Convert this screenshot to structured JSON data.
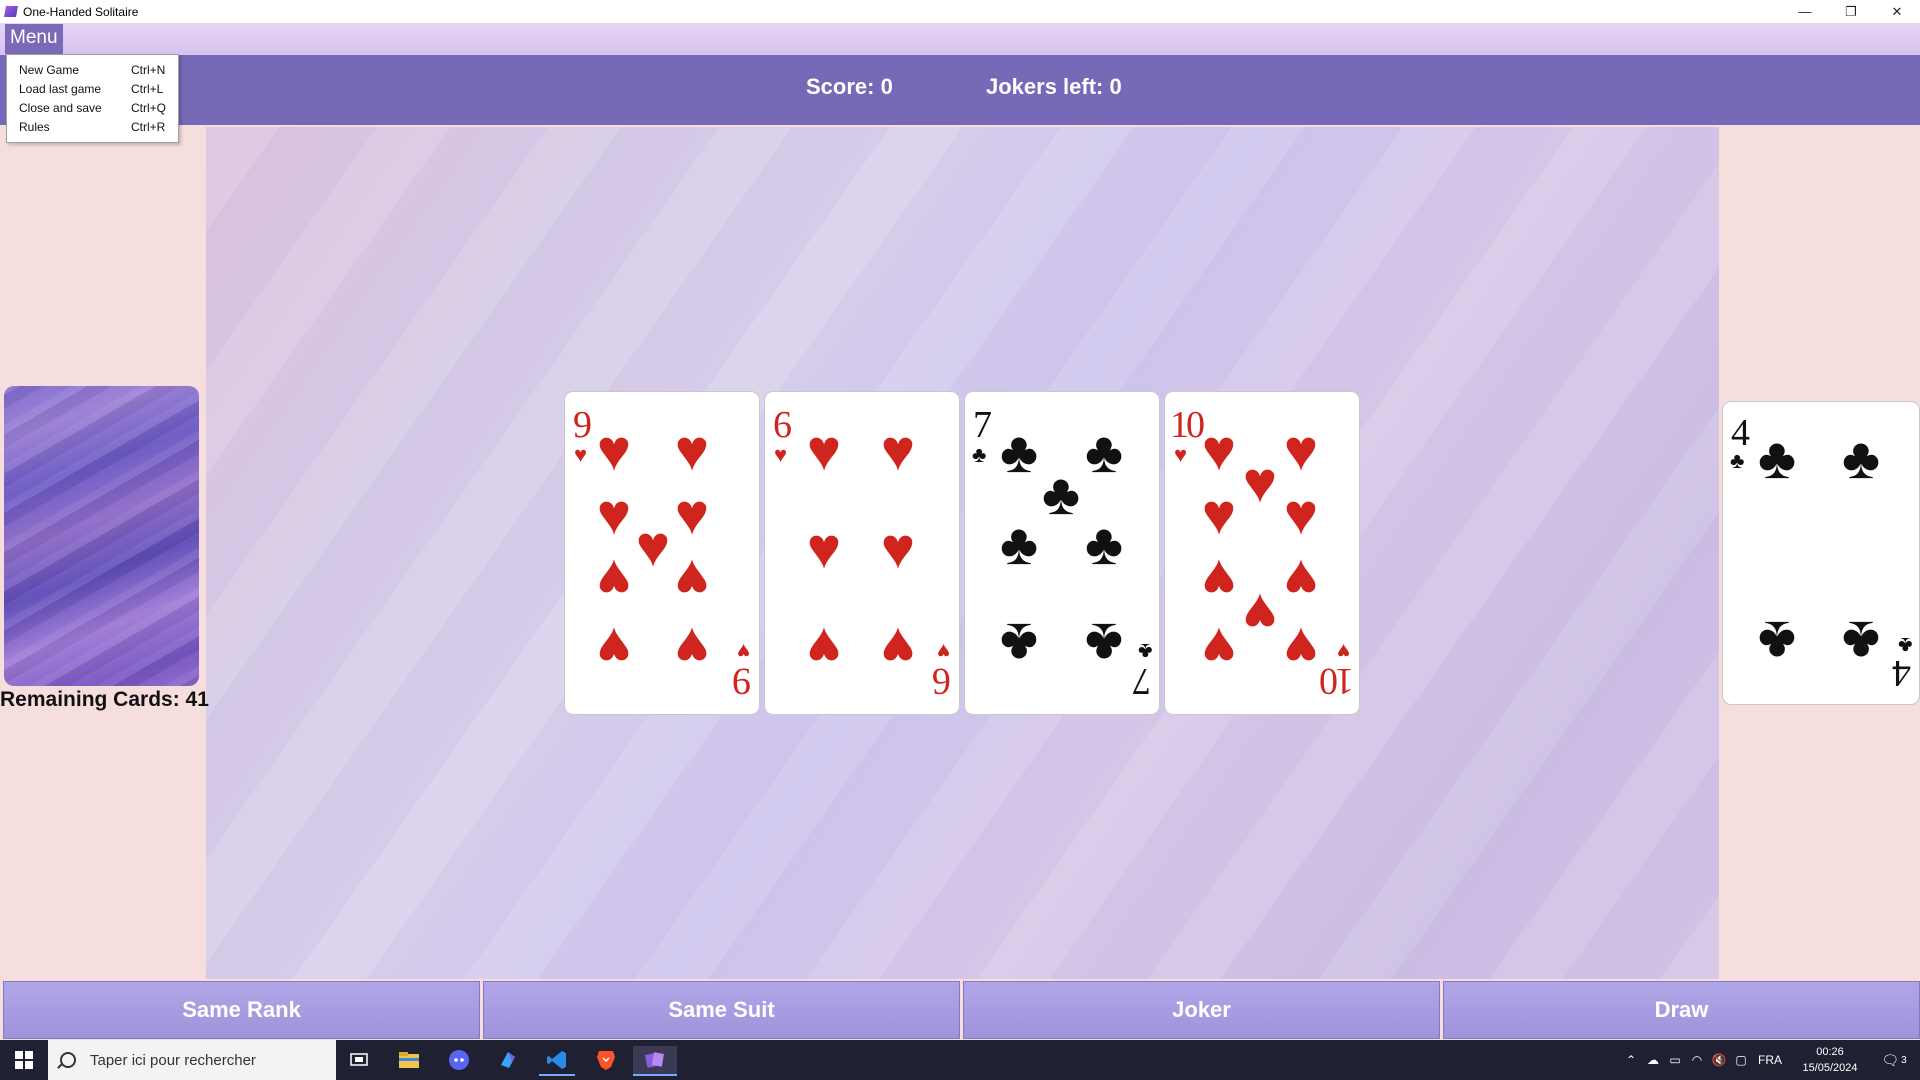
{
  "window": {
    "title": "One-Handed Solitaire",
    "minimize": "—",
    "restore": "❐",
    "close": "✕"
  },
  "menu": {
    "label": "Menu",
    "items": [
      {
        "label": "New Game",
        "shortcut": "Ctrl+N"
      },
      {
        "label": "Load last game",
        "shortcut": "Ctrl+L"
      },
      {
        "label": "Close and save",
        "shortcut": "Ctrl+Q"
      },
      {
        "label": "Rules",
        "shortcut": "Ctrl+R"
      }
    ]
  },
  "header": {
    "score": "Score: 0",
    "jokers": "Jokers left: 0"
  },
  "deck": {
    "remaining": "Remaining Cards: 41"
  },
  "hand": [
    {
      "rank": "9",
      "suit": "♥",
      "color": "red"
    },
    {
      "rank": "6",
      "suit": "♥",
      "color": "red"
    },
    {
      "rank": "7",
      "suit": "♣",
      "color": "black"
    },
    {
      "rank": "10",
      "suit": "♥",
      "color": "red"
    }
  ],
  "side_card": {
    "rank": "4",
    "suit": "♣",
    "color": "black"
  },
  "buttons": {
    "same_rank": "Same Rank",
    "same_suit": "Same Suit",
    "joker": "Joker",
    "draw": "Draw"
  },
  "taskbar": {
    "search_placeholder": "Taper ici pour rechercher",
    "language": "FRA",
    "time": "00:26",
    "date": "15/05/2024",
    "notifications": "3"
  },
  "colors": {
    "header": "#7569b8",
    "button": "#a89ee2",
    "red_suit": "#d0241e"
  }
}
